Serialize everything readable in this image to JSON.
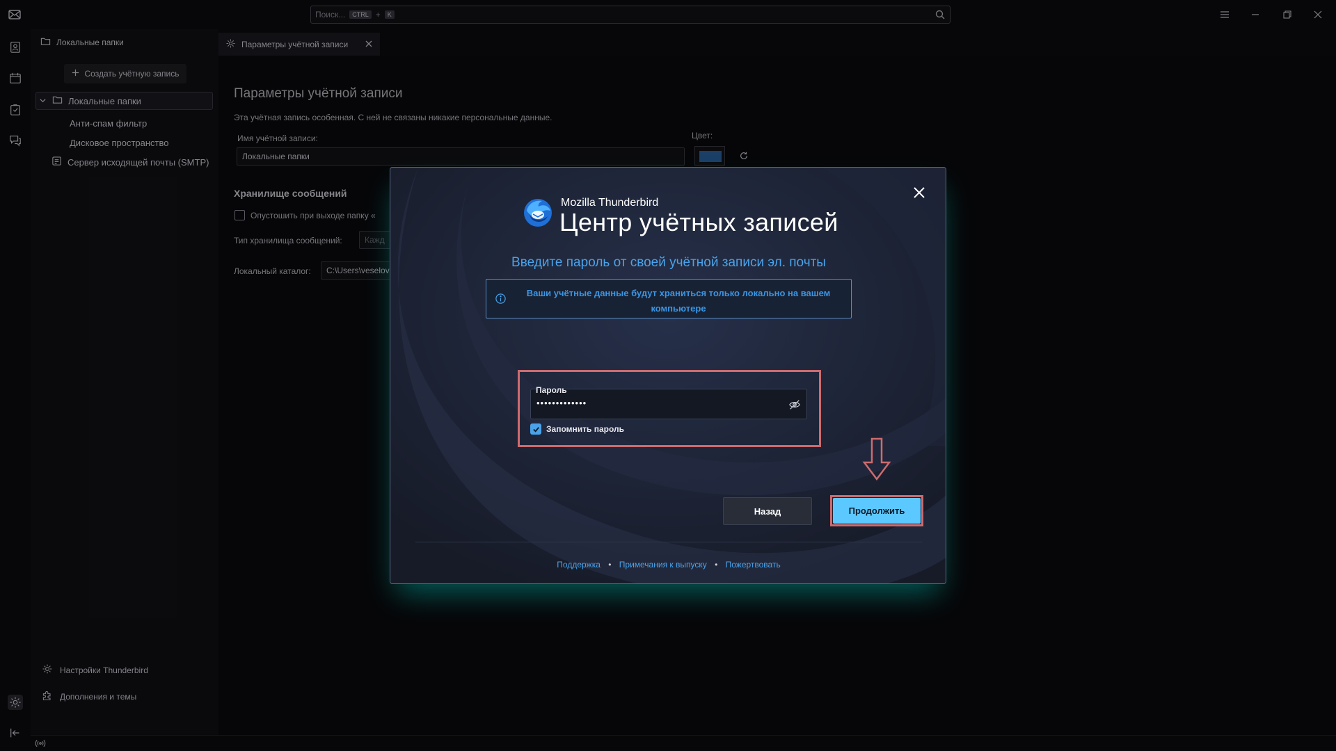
{
  "search": {
    "placeholder": "Поиск...",
    "kbd_ctrl": "CTRL",
    "kbd_plus": "+",
    "kbd_key": "K"
  },
  "tabs": [
    {
      "label": "Локальные папки"
    },
    {
      "label": "Параметры учётной записи"
    }
  ],
  "folder_pane": {
    "create_account": "Создать учётную запись",
    "items": [
      {
        "label": "Локальные папки"
      },
      {
        "label": "Анти-спам фильтр"
      },
      {
        "label": "Дисковое пространство"
      },
      {
        "label": "Сервер исходящей почты (SMTP)"
      }
    ],
    "settings": "Настройки Thunderbird",
    "addons": "Дополнения и темы"
  },
  "account_settings": {
    "title": "Параметры учётной записи",
    "description": "Эта учётная запись особенная. С ней не связаны никакие персональные данные.",
    "name_label": "Имя учётной записи:",
    "name_value": "Локальные папки",
    "color_label": "Цвет:",
    "color_value": "#2d66a6",
    "storage_heading": "Хранилище сообщений",
    "empty_on_exit": "Опустошить при выходе папку «",
    "storage_type_label": "Тип хранилища сообщений:",
    "storage_type_value": "Кажд",
    "local_dir_label": "Локальный каталог:",
    "local_dir_value": "C:\\Users\\veselov"
  },
  "dialog": {
    "brand_name": "Mozilla Thunderbird",
    "brand_title": "Центр учётных записей",
    "headline": "Введите пароль от своей учётной записи эл. почты",
    "info_message": "Ваши учётные данные будут храниться только локально на вашем компьютере",
    "password_label": "Пароль",
    "password_value": "•••••••••••••",
    "remember_label": "Запомнить пароль",
    "remember_checked": true,
    "back_button": "Назад",
    "continue_button": "Продолжить",
    "footer": {
      "support": "Поддержка",
      "release_notes": "Примечания к выпуску",
      "donate": "Пожертвовать",
      "separator": "•"
    }
  },
  "colors": {
    "accent": "#5bc8ff",
    "link": "#4aa3ea",
    "highlight": "#cd6b6e"
  }
}
